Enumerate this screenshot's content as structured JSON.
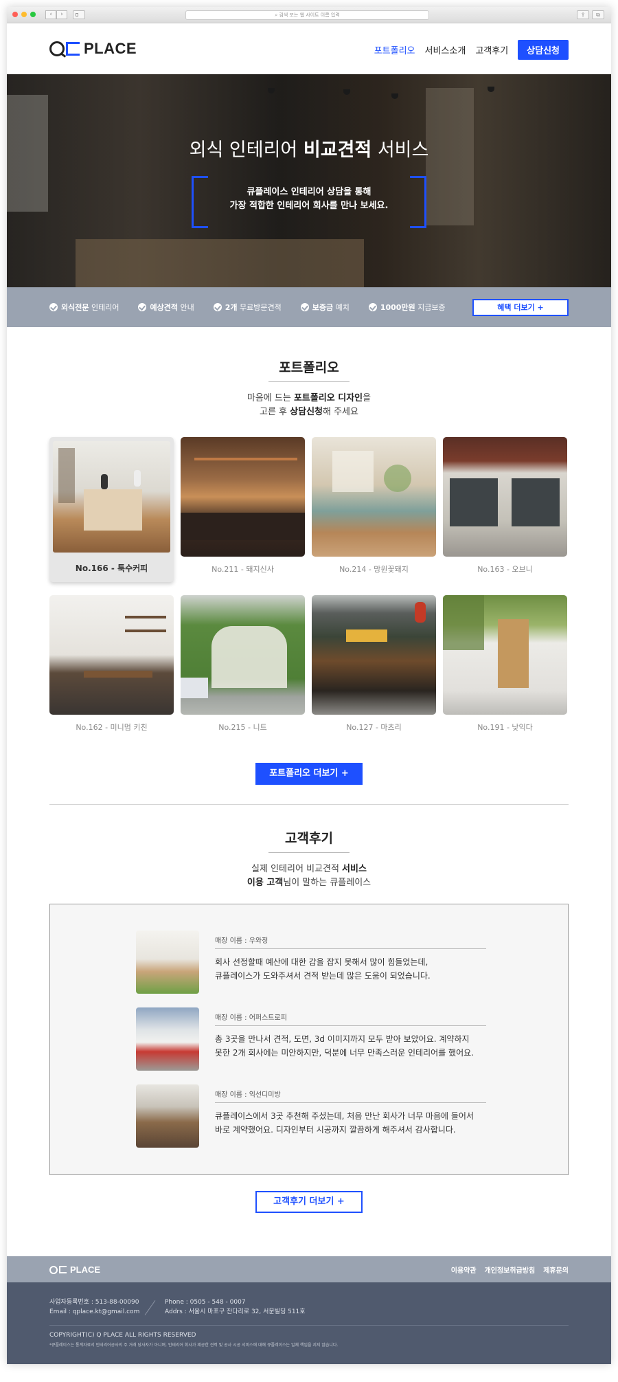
{
  "browser": {
    "url_placeholder": "검색 또는 웹 사이트 이름 입력",
    "back_glyph": "‹",
    "forward_glyph": "›",
    "share_glyph": "⇪",
    "tabs_glyph": "⧉",
    "add_glyph": "+",
    "lights": [
      "#fe5f57",
      "#febc2e",
      "#28c840"
    ]
  },
  "header": {
    "logo_text": "PLACE",
    "nav": [
      {
        "label": "포트폴리오",
        "active": true
      },
      {
        "label": "서비스소개",
        "active": false
      },
      {
        "label": "고객후기",
        "active": false
      }
    ],
    "cta_label": "상담신청"
  },
  "hero": {
    "title_pre": "외식 인테리어 ",
    "title_bold": "비교견적",
    "title_post": " 서비스",
    "sub_line1": "큐플레이스 인테리어 상담을 통해",
    "sub_line2": "가장 적합한 인테리어 회사를 만나 보세요."
  },
  "benefits": {
    "items": [
      {
        "bold": "외식전문",
        "rest": " 인테리어"
      },
      {
        "bold": "예상견적",
        "rest": " 안내"
      },
      {
        "bold": "2개",
        "rest": " 무료방문견적"
      },
      {
        "bold": "보증금",
        "rest": " 예치"
      },
      {
        "bold": "1000만원",
        "rest": " 지급보증"
      }
    ],
    "more_label": "혜택 더보기 +"
  },
  "portfolio": {
    "title": "포트폴리오",
    "sub_line1_pre": "마음에 드는 ",
    "sub_line1_bold": "포트폴리오 디자인",
    "sub_line1_post": "을",
    "sub_line2_pre": "고른 후 ",
    "sub_line2_bold": "상담신청",
    "sub_line2_post": "해 주세요",
    "items": [
      {
        "caption": "No.166 - 툭수커피"
      },
      {
        "caption": "No.211 - 돼지신사"
      },
      {
        "caption": "No.214 - 망원꽃돼지"
      },
      {
        "caption": "No.163 - 오브니"
      },
      {
        "caption": "No.162 - 미니멈 키친"
      },
      {
        "caption": "No.215 - 니트"
      },
      {
        "caption": "No.127 - 마츠리"
      },
      {
        "caption": "No.191 - 낮익다"
      }
    ],
    "more_label": "포트폴리오 더보기 +"
  },
  "reviews": {
    "title": "고객후기",
    "sub_line1_pre": "실제 인테리어 비교견적 ",
    "sub_line1_bold": "서비스",
    "sub_line2_bold": "이용 고객",
    "sub_line2_post": "님이 말하는 큐플레이스",
    "items": [
      {
        "name": "매장 이름 : 우와정",
        "text1": "회사 선정할때 예산에 대한 감을 잡지 못해서 많이 힘들었는데,",
        "text2": "큐플레이스가 도와주셔서 견적 받는데 많은 도움이 되었습니다."
      },
      {
        "name": "매장 이름 : 어퍼스트로피",
        "text1": "총 3곳을 만나서 견적, 도면, 3d 이미지까지 모두 받아 보았어요. 계약하지",
        "text2": "못한 2개 회사에는 미안하지만, 덕분에 너무 만족스러운 인테리어를 했어요."
      },
      {
        "name": "매장 이름 : 익선디미방",
        "text1": "큐플레이스에서 3곳 추천해 주셨는데, 처음 만난 회사가 너무 마음에 들어서",
        "text2": "바로 계약했어요. 디자인부터 시공까지 깔끔하게 해주셔서 감사합니다."
      }
    ],
    "more_label": "고객후기 더보기 +"
  },
  "footer": {
    "logo_text": "PLACE",
    "links": [
      "이용약관",
      "개인정보취급방침",
      "제휴문의"
    ],
    "biz_no": "사업자등록번호 : 513-88-00090",
    "email": "Email : qplace.kt@gmail.com",
    "phone": "Phone : 0505 - 548 - 0007",
    "address": "Addrs : 서울시 마포구 잔다리로 32, 서문빌딩 511호",
    "copyright": "COPYRIGHT(C) Q PLACE ALL RIGHTS RESERVED",
    "note": "*큐플레이스는 통계자료서 인테리어공사의 주 거래 당사자가 아니며, 인테리어 회사가 제공한 견적 및 공사 시공 서비스에 대해 큐플레이스는 일체 책임을 지지 않습니다."
  },
  "colors": {
    "accent": "#1e50ff",
    "band": "#9aa3b1",
    "footer": "#505a6e"
  }
}
